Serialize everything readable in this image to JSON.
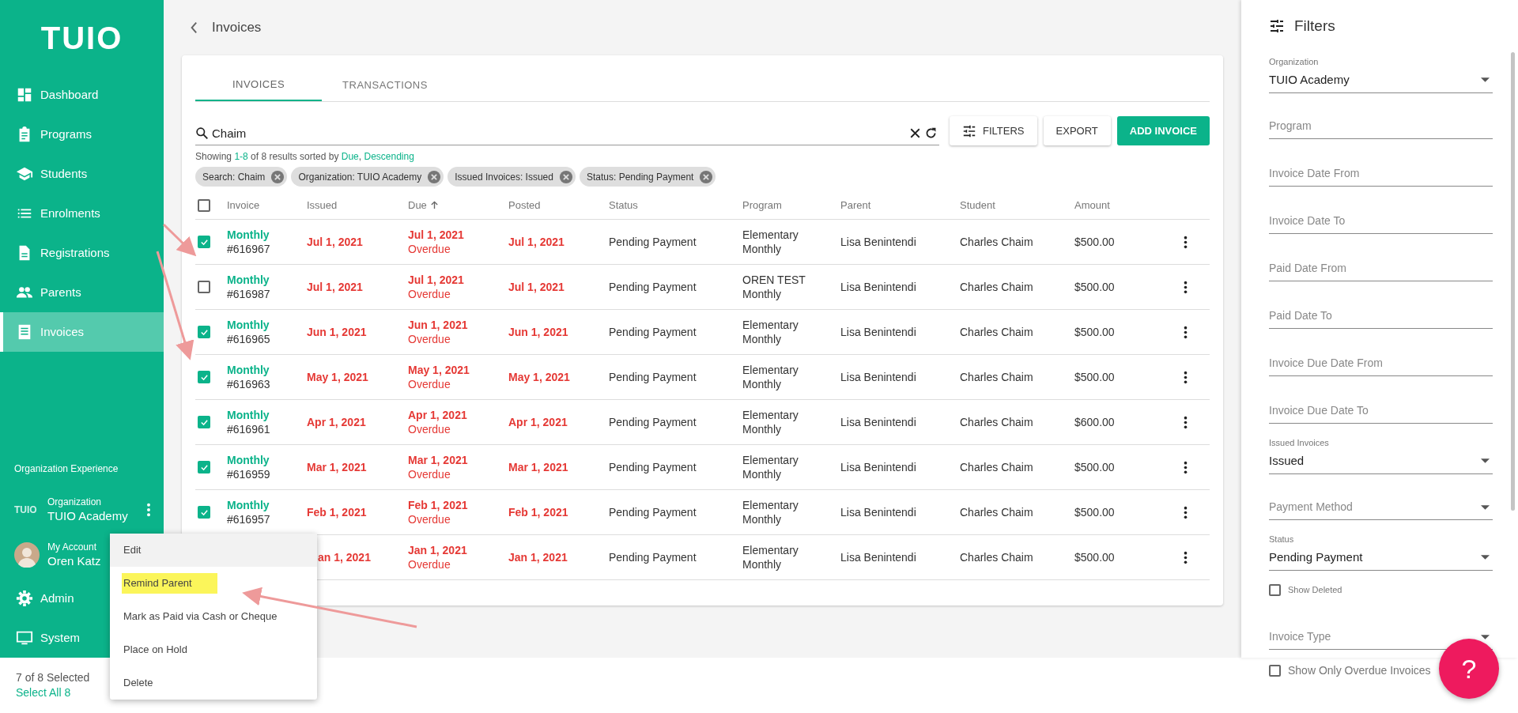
{
  "sidebar": {
    "logo": "TUIO",
    "items": [
      {
        "label": "Dashboard",
        "kind": "dashboard",
        "selected": false
      },
      {
        "label": "Programs",
        "kind": "clipboard",
        "selected": false
      },
      {
        "label": "Students",
        "kind": "cap",
        "selected": false
      },
      {
        "label": "Enrolments",
        "kind": "list",
        "selected": false
      },
      {
        "label": "Registrations",
        "kind": "document",
        "selected": false
      },
      {
        "label": "Parents",
        "kind": "people",
        "selected": false
      },
      {
        "label": "Invoices",
        "kind": "receipt",
        "selected": true
      }
    ],
    "org_heading": "Organization Experience",
    "organization": {
      "logo": "TUIO",
      "label": "Organization",
      "name": "TUIO Academy"
    },
    "account": {
      "label": "My Account",
      "name": "Oren Katz"
    },
    "bottom_items": [
      {
        "label": "Admin",
        "kind": "gear"
      },
      {
        "label": "System",
        "kind": "monitor"
      }
    ]
  },
  "header": {
    "title": "Invoices"
  },
  "tabs": [
    {
      "label": "INVOICES",
      "selected": true
    },
    {
      "label": "TRANSACTIONS",
      "selected": false
    }
  ],
  "search": {
    "value": "Chaim"
  },
  "buttons": [
    {
      "label": "FILTERS",
      "kind": "filter"
    },
    {
      "label": "EXPORT",
      "kind": "outlined"
    },
    {
      "label": "ADD INVOICE",
      "kind": "primary"
    }
  ],
  "summary": [
    {
      "text": "Showing ",
      "highlight": false
    },
    {
      "text": "1-8",
      "highlight": true
    },
    {
      "text": " of 8 results sorted by ",
      "highlight": false
    },
    {
      "text": "Due",
      "highlight": true
    },
    {
      "text": ", ",
      "highlight": false
    },
    {
      "text": "Descending",
      "highlight": true
    }
  ],
  "chips": [
    "Search: Chaim",
    "Organization: TUIO Academy",
    "Issued Invoices: Issued",
    "Status: Pending Payment"
  ],
  "table": {
    "select_all_checked": false,
    "columns": [
      {
        "label": "Invoice",
        "sorted": false
      },
      {
        "label": "Issued",
        "sorted": false
      },
      {
        "label": "Due",
        "sorted": true
      },
      {
        "label": "Posted",
        "sorted": false
      },
      {
        "label": "Status",
        "sorted": false
      },
      {
        "label": "Program",
        "sorted": false
      },
      {
        "label": "Parent",
        "sorted": false
      },
      {
        "label": "Student",
        "sorted": false
      },
      {
        "label": "Amount",
        "sorted": false
      }
    ],
    "rows": [
      {
        "checked": true,
        "invoice_type": "Monthly",
        "number": "#616967",
        "overdue": true,
        "issued": "Jul 1, 2021",
        "due": "Jul 1, 2021",
        "due_note": "Overdue",
        "posted": "Jul 1, 2021",
        "status": "Pending Payment",
        "program": "Elementary Monthly",
        "parent": "Lisa Benintendi",
        "student": "Charles Chaim",
        "amount": "$500.00"
      },
      {
        "checked": false,
        "invoice_type": "Monthly",
        "number": "#616987",
        "overdue": true,
        "issued": "Jul 1, 2021",
        "due": "Jul 1, 2021",
        "due_note": "Overdue",
        "posted": "Jul 1, 2021",
        "status": "Pending Payment",
        "program": "OREN TEST Monthly",
        "parent": "Lisa Benintendi",
        "student": "Charles Chaim",
        "amount": "$500.00"
      },
      {
        "checked": true,
        "invoice_type": "Monthly",
        "number": "#616965",
        "overdue": true,
        "issued": "Jun 1, 2021",
        "due": "Jun 1, 2021",
        "due_note": "Overdue",
        "posted": "Jun 1, 2021",
        "status": "Pending Payment",
        "program": "Elementary Monthly",
        "parent": "Lisa Benintendi",
        "student": "Charles Chaim",
        "amount": "$500.00"
      },
      {
        "checked": true,
        "invoice_type": "Monthly",
        "number": "#616963",
        "overdue": true,
        "issued": "May 1, 2021",
        "due": "May 1, 2021",
        "due_note": "Overdue",
        "posted": "May 1, 2021",
        "status": "Pending Payment",
        "program": "Elementary Monthly",
        "parent": "Lisa Benintendi",
        "student": "Charles Chaim",
        "amount": "$500.00"
      },
      {
        "checked": true,
        "invoice_type": "Monthly",
        "number": "#616961",
        "overdue": true,
        "issued": "Apr 1, 2021",
        "due": "Apr 1, 2021",
        "due_note": "Overdue",
        "posted": "Apr 1, 2021",
        "status": "Pending Payment",
        "program": "Elementary Monthly",
        "parent": "Lisa Benintendi",
        "student": "Charles Chaim",
        "amount": "$600.00"
      },
      {
        "checked": true,
        "invoice_type": "Monthly",
        "number": "#616959",
        "overdue": true,
        "issued": "Mar 1, 2021",
        "due": "Mar 1, 2021",
        "due_note": "Overdue",
        "posted": "Mar 1, 2021",
        "status": "Pending Payment",
        "program": "Elementary Monthly",
        "parent": "Lisa Benintendi",
        "student": "Charles Chaim",
        "amount": "$500.00"
      },
      {
        "checked": true,
        "invoice_type": "Monthly",
        "number": "#616957",
        "overdue": true,
        "issued": "Feb 1, 2021",
        "due": "Feb 1, 2021",
        "due_note": "Overdue",
        "posted": "Feb 1, 2021",
        "status": "Pending Payment",
        "program": "Elementary Monthly",
        "parent": "Lisa Benintendi",
        "student": "Charles Chaim",
        "amount": "$500.00"
      },
      {
        "overdue": true,
        "issued": "an 1, 2021",
        "due": "Jan 1, 2021",
        "due_note": "Overdue",
        "posted": "Jan 1, 2021",
        "status": "Pending Payment",
        "program": "Elementary Monthly",
        "parent": "Lisa Benintendi",
        "student": "Charles Chaim",
        "amount": "$500.00"
      }
    ]
  },
  "context_menu": [
    {
      "label": "Edit",
      "hovered": true,
      "highlighted": false
    },
    {
      "label": "Remind Parent",
      "hovered": false,
      "highlighted": true
    },
    {
      "label": "Mark as Paid via Cash or Cheque",
      "hovered": false,
      "highlighted": false
    },
    {
      "label": "Place on Hold",
      "hovered": false,
      "highlighted": false
    },
    {
      "label": "Delete",
      "hovered": false,
      "highlighted": false
    }
  ],
  "selection_bar": {
    "count": "7 of 8 Selected",
    "select_all": "Select All 8"
  },
  "filters": {
    "title": "Filters",
    "fields": [
      {
        "kind": "select",
        "label": "Organization",
        "value": "TUIO Academy"
      },
      {
        "kind": "text",
        "placeholder": "Program"
      },
      {
        "kind": "text",
        "placeholder": "Invoice Date From"
      },
      {
        "kind": "text",
        "placeholder": "Invoice Date To"
      },
      {
        "kind": "text",
        "placeholder": "Paid Date From"
      },
      {
        "kind": "text",
        "placeholder": "Paid Date To"
      },
      {
        "kind": "text",
        "placeholder": "Invoice Due Date From"
      },
      {
        "kind": "text",
        "placeholder": "Invoice Due Date To"
      },
      {
        "kind": "select",
        "label": "Issued Invoices",
        "value": "Issued"
      },
      {
        "kind": "select",
        "placeholder": "Payment Method"
      },
      {
        "kind": "select",
        "label": "Status",
        "value": "Pending Payment"
      },
      {
        "kind": "checkbox",
        "label": "Show Deleted",
        "checked": false
      },
      {
        "kind": "select",
        "placeholder": "Invoice Type"
      },
      {
        "kind": "checkbox",
        "label": "Show Only Overdue Invoices",
        "checked": false
      }
    ]
  },
  "help_button": {
    "label": "?"
  }
}
